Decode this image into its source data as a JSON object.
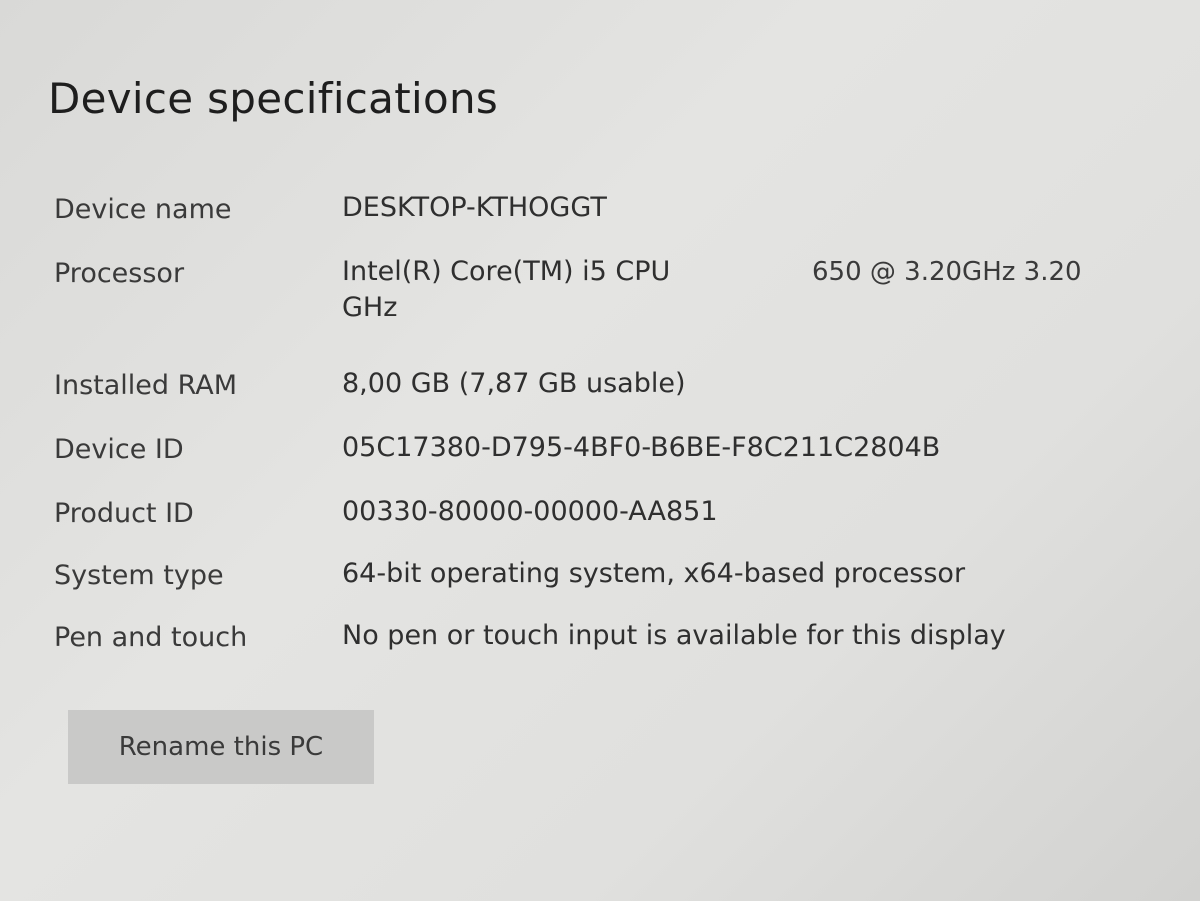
{
  "section_title": "Device specifications",
  "specs": {
    "device_name": {
      "label": "Device name",
      "value": "DESKTOP-KTHOGGT"
    },
    "processor": {
      "label": "Processor",
      "value_main": "Intel(R) Core(TM) i5 CPU",
      "value_extra": "650 @ 3.20GHz 3.20",
      "value_wrap": "GHz"
    },
    "installed_ram": {
      "label": "Installed RAM",
      "value": "8,00 GB (7,87 GB usable)"
    },
    "device_id": {
      "label": "Device ID",
      "value": "05C17380-D795-4BF0-B6BE-F8C211C2804B"
    },
    "product_id": {
      "label": "Product ID",
      "value": "00330-80000-00000-AA851"
    },
    "system_type": {
      "label": "System type",
      "value": "64-bit operating system, x64-based processor"
    },
    "pen_and_touch": {
      "label": "Pen and touch",
      "value": "No pen or touch input is available for this display"
    }
  },
  "rename_button_label": "Rename this PC"
}
